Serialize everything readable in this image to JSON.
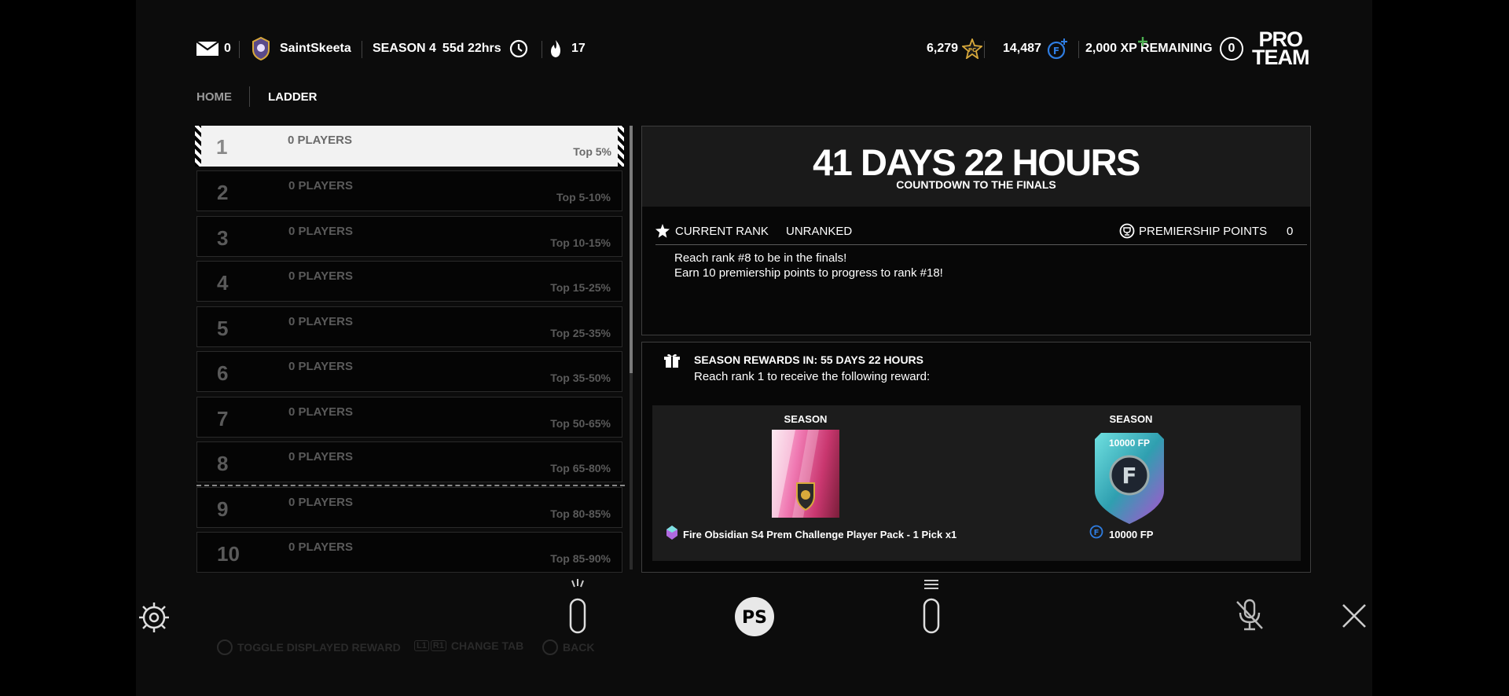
{
  "header": {
    "mail_count": "0",
    "username": "SaintSkeeta",
    "season": "SEASON 4",
    "season_time": "55d 22hrs",
    "streak": "17",
    "coins": "6,279",
    "fifa_points": "14,487",
    "xp_remaining": "2,000 XP REMAINING",
    "level": "0",
    "pro_line1": "PRO",
    "pro_line2": "TEAM"
  },
  "nav": {
    "home": "HOME",
    "ladder": "LADDER"
  },
  "ladder": [
    {
      "rank": "1",
      "players": "0 PLAYERS",
      "tier": "Top 5%"
    },
    {
      "rank": "2",
      "players": "0 PLAYERS",
      "tier": "Top 5-10%"
    },
    {
      "rank": "3",
      "players": "0 PLAYERS",
      "tier": "Top 10-15%"
    },
    {
      "rank": "4",
      "players": "0 PLAYERS",
      "tier": "Top 15-25%"
    },
    {
      "rank": "5",
      "players": "0 PLAYERS",
      "tier": "Top 25-35%"
    },
    {
      "rank": "6",
      "players": "0 PLAYERS",
      "tier": "Top 35-50%"
    },
    {
      "rank": "7",
      "players": "0 PLAYERS",
      "tier": "Top 50-65%"
    },
    {
      "rank": "8",
      "players": "0 PLAYERS",
      "tier": "Top 65-80%"
    },
    {
      "rank": "9",
      "players": "0 PLAYERS",
      "tier": "Top 80-85%"
    },
    {
      "rank": "10",
      "players": "0 PLAYERS",
      "tier": "Top 85-90%"
    }
  ],
  "finals": {
    "countdown": "41 DAYS 22 HOURS",
    "subtitle": "COUNTDOWN TO THE FINALS",
    "current_rank_label": "CURRENT RANK",
    "current_rank_value": "UNRANKED",
    "points_label": "PREMIERSHIP POINTS",
    "points_value": "0",
    "line1": "Reach rank #8 to be in the finals!",
    "line2": "Earn 10 premiership points to progress to rank #18!"
  },
  "rewards": {
    "title": "SEASON REWARDS IN: 55 DAYS 22 HOURS",
    "subtitle": "Reach rank 1 to receive the following reward:",
    "items": [
      {
        "label": "SEASON",
        "name": "Fire Obsidian S4 Prem Challenge Player Pack - 1 Pick x1"
      },
      {
        "label": "SEASON",
        "badge": "10000 FP",
        "name": "10000 FP"
      }
    ]
  },
  "legend": {
    "toggle": "TOGGLE DISPLAYED REWARD",
    "change_tab": "CHANGE TAB",
    "back": "BACK",
    "l1": "L1",
    "r1": "R1"
  },
  "colors": {
    "accent_blue": "#2f7de1",
    "gold": "#d9a93b",
    "background": "#0c0c0c"
  }
}
